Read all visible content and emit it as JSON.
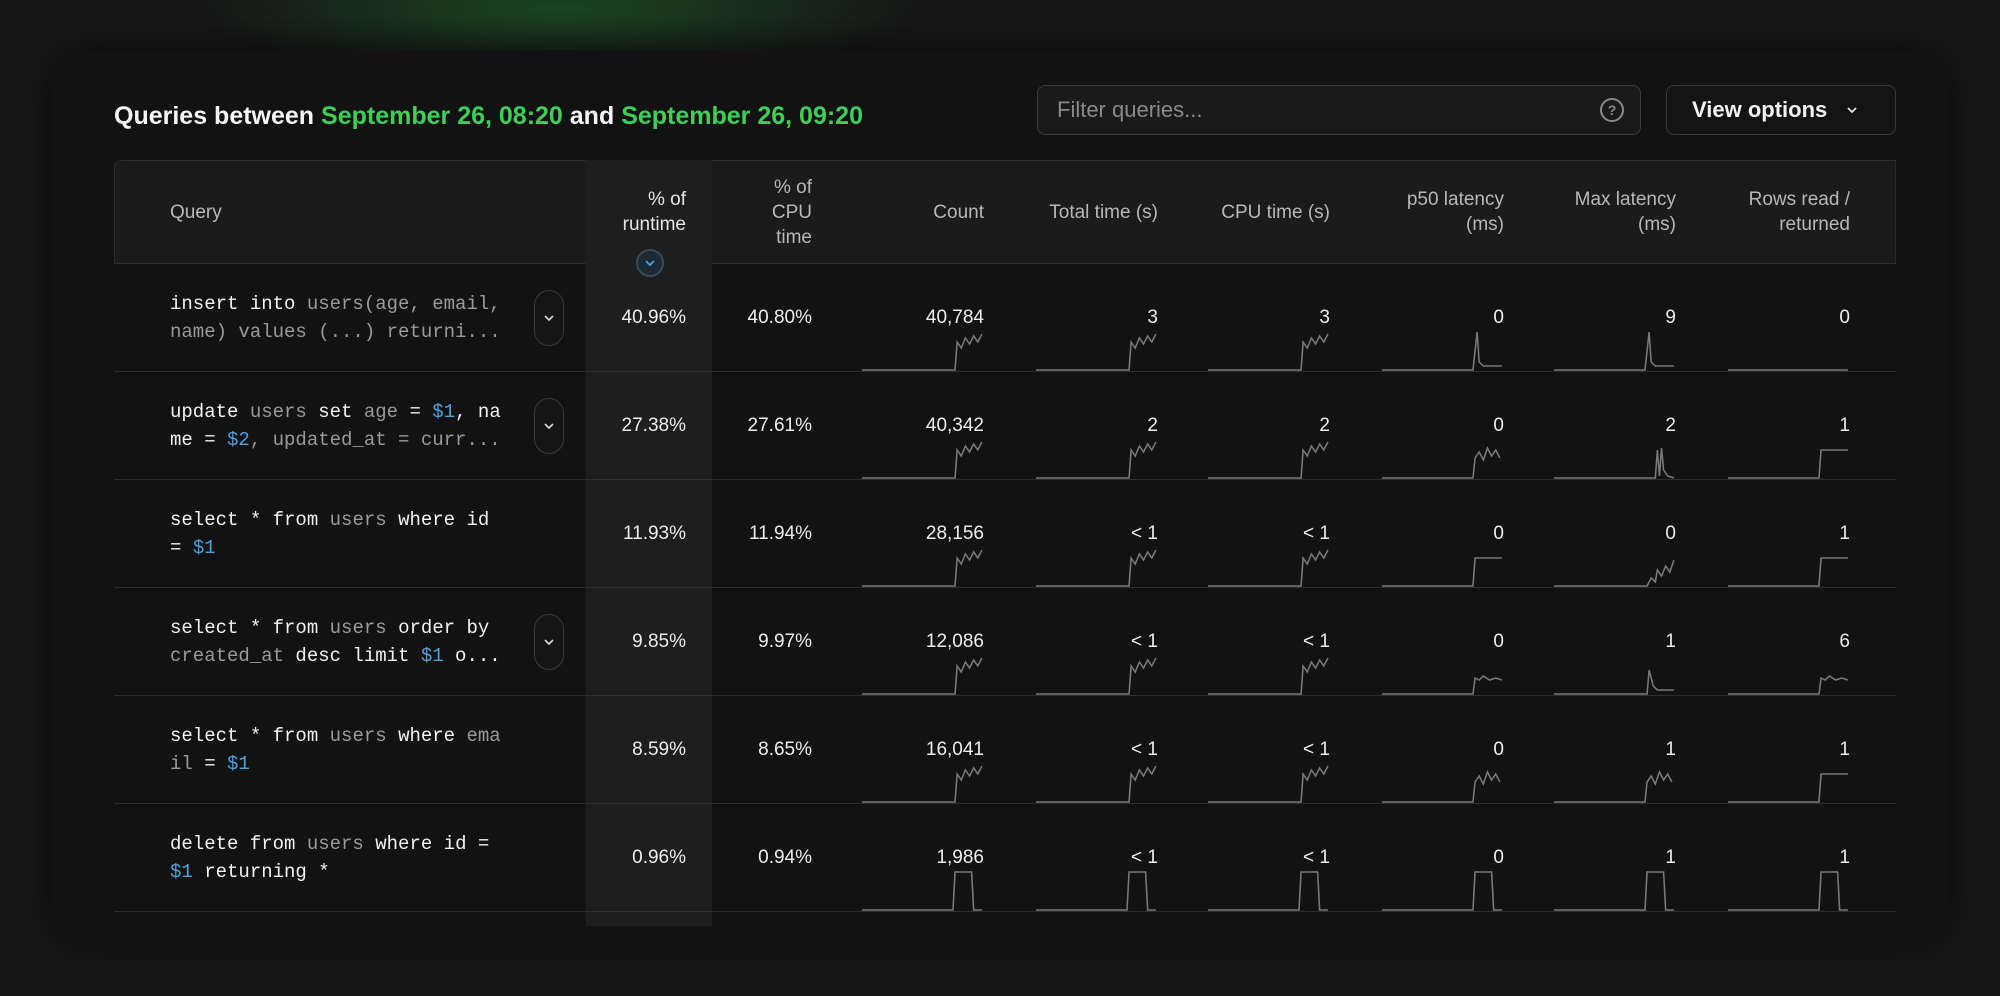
{
  "header": {
    "title_prefix": "Queries between",
    "start": "September 26, 08:20",
    "title_mid": "and",
    "end": "September 26, 09:20"
  },
  "filter": {
    "placeholder": "Filter queries...",
    "help_icon": "?"
  },
  "view_options": {
    "label": "View options"
  },
  "columns": [
    {
      "label": "Query"
    },
    {
      "label": "% of runtime",
      "sorted": true
    },
    {
      "label": "% of CPU time"
    },
    {
      "label": "Count"
    },
    {
      "label": "Total time (s)"
    },
    {
      "label": "CPU time (s)"
    },
    {
      "label": "p50 latency (ms)"
    },
    {
      "label": "Max latency (ms)"
    },
    {
      "label": "Rows read / returned"
    }
  ],
  "header_lines": {
    "query": [
      "Query"
    ],
    "runtime": [
      "% of",
      "runtime"
    ],
    "cpu": [
      "% of",
      "CPU",
      "time"
    ],
    "count": [
      "Count"
    ],
    "total": [
      "Total time (s)"
    ],
    "cputime": [
      "CPU time (s)"
    ],
    "p50": [
      "p50 latency",
      "(ms)"
    ],
    "max": [
      "Max latency",
      "(ms)"
    ],
    "rows": [
      "Rows read /",
      "returned"
    ]
  },
  "rows": [
    {
      "query_lines": [
        [
          {
            "k": "insert into"
          },
          {
            "t": " users(age, email,"
          }
        ],
        [
          {
            "t": "name) values (...) returni..."
          }
        ]
      ],
      "expandable": true,
      "runtime": "40.96%",
      "cpu_pct": "40.80%",
      "count": "40,784",
      "total_time": "3",
      "cpu_time": "3",
      "p50": "0",
      "max_latency": "9",
      "rows": "0"
    },
    {
      "query_lines": [
        [
          {
            "k": "update"
          },
          {
            "t": " users "
          },
          {
            "k": "set"
          },
          {
            "t": " age "
          },
          {
            "k": "="
          },
          {
            "p": " $1"
          },
          {
            "k": ", na"
          }
        ],
        [
          {
            "k": "me = "
          },
          {
            "p": "$2"
          },
          {
            "t": ", updated_at = curr..."
          }
        ]
      ],
      "expandable": true,
      "runtime": "27.38%",
      "cpu_pct": "27.61%",
      "count": "40,342",
      "total_time": "2",
      "cpu_time": "2",
      "p50": "0",
      "max_latency": "2",
      "rows": "1"
    },
    {
      "query_lines": [
        [
          {
            "k": "select * from"
          },
          {
            "t": " users "
          },
          {
            "k": "where id"
          }
        ],
        [
          {
            "k": "= "
          },
          {
            "p": "$1"
          }
        ]
      ],
      "expandable": false,
      "runtime": "11.93%",
      "cpu_pct": "11.94%",
      "count": "28,156",
      "total_time": "< 1",
      "cpu_time": "< 1",
      "p50": "0",
      "max_latency": "0",
      "rows": "1"
    },
    {
      "query_lines": [
        [
          {
            "k": "select * from"
          },
          {
            "t": " users "
          },
          {
            "k": "order by"
          }
        ],
        [
          {
            "t": "created_at "
          },
          {
            "k": "desc limit "
          },
          {
            "p": "$1"
          },
          {
            "k": " o..."
          }
        ]
      ],
      "expandable": true,
      "runtime": "9.85%",
      "cpu_pct": "9.97%",
      "count": "12,086",
      "total_time": "< 1",
      "cpu_time": "< 1",
      "p50": "0",
      "max_latency": "1",
      "rows": "6"
    },
    {
      "query_lines": [
        [
          {
            "k": "select * from"
          },
          {
            "t": " users "
          },
          {
            "k": "where "
          },
          {
            "t": "ema"
          }
        ],
        [
          {
            "t": "il "
          },
          {
            "k": "= "
          },
          {
            "p": "$1"
          }
        ]
      ],
      "expandable": false,
      "runtime": "8.59%",
      "cpu_pct": "8.65%",
      "count": "16,041",
      "total_time": "< 1",
      "cpu_time": "< 1",
      "p50": "0",
      "max_latency": "1",
      "rows": "1"
    },
    {
      "query_lines": [
        [
          {
            "k": "delete from"
          },
          {
            "t": " users "
          },
          {
            "k": "where id ="
          }
        ],
        [
          {
            "p": "$1"
          },
          {
            "k": " returning *"
          }
        ]
      ],
      "expandable": false,
      "runtime": "0.96%",
      "cpu_pct": "0.94%",
      "count": "1,986",
      "total_time": "< 1",
      "cpu_time": "< 1",
      "p50": "0",
      "max_latency": "1",
      "rows": "1"
    }
  ]
}
